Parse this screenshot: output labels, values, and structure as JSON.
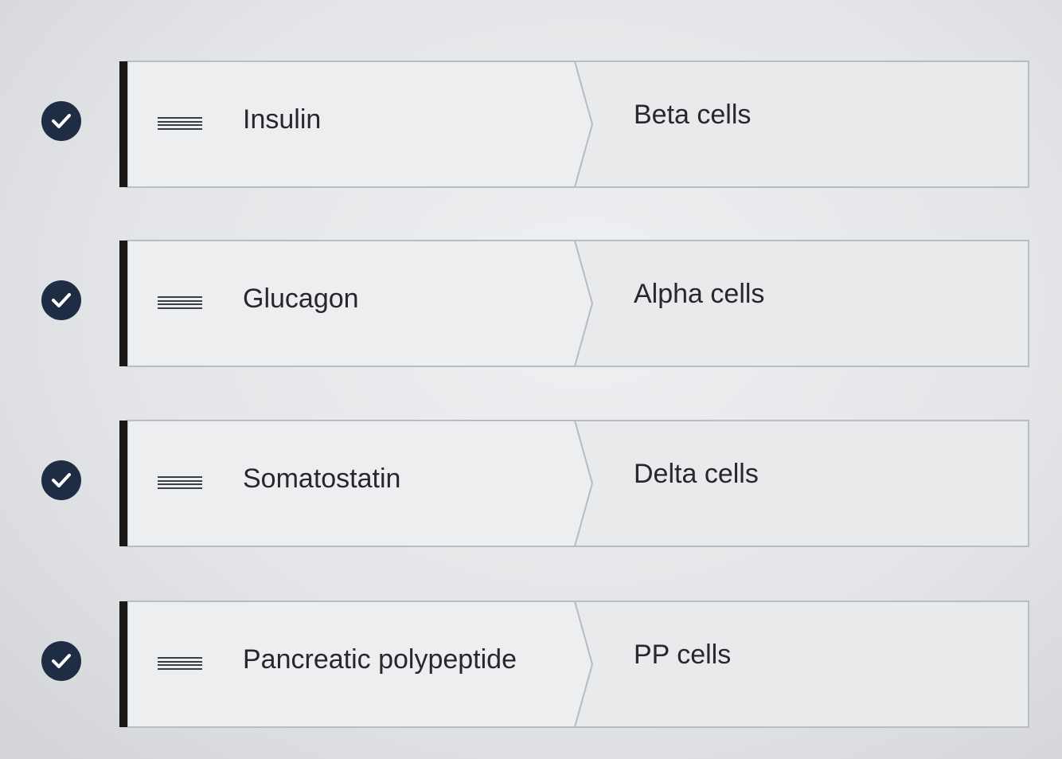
{
  "matching": {
    "pairs": [
      {
        "term": "Insulin",
        "match": "Beta cells",
        "status": "correct"
      },
      {
        "term": "Glucagon",
        "match": "Alpha cells",
        "status": "correct"
      },
      {
        "term": "Somatostatin",
        "match": "Delta cells",
        "status": "correct"
      },
      {
        "term": "Pancreatic polypeptide",
        "match": "PP cells",
        "status": "correct"
      }
    ]
  },
  "icons": {
    "status": "check-circle-icon",
    "drag": "drag-handle-icon"
  },
  "colors": {
    "check_circle": "#1f2d44",
    "accent_bar": "#1c1717",
    "text": "#26282c"
  }
}
